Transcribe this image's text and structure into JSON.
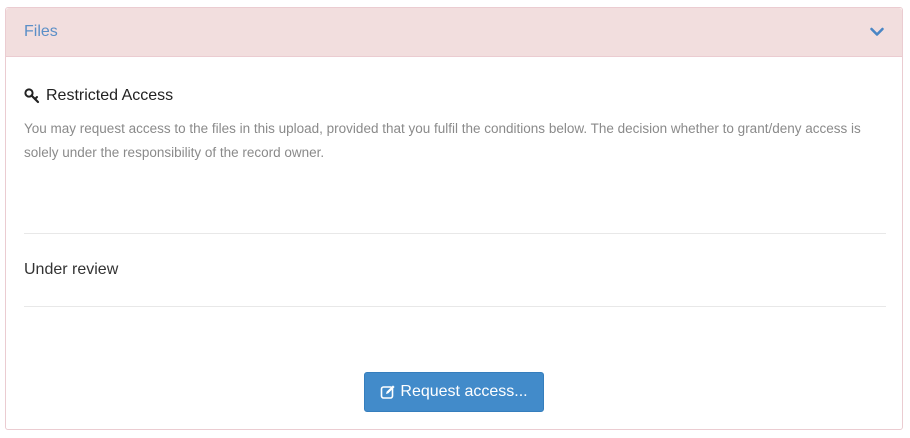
{
  "panel": {
    "title": "Files",
    "toggle_icon": "chevron-down-icon"
  },
  "access": {
    "icon": "key-icon",
    "heading": "Restricted Access",
    "description": "You may request access to the files in this upload, provided that you fulfil the conditions below. The decision whether to grant/deny access is solely under the responsibility of the record owner."
  },
  "status": {
    "text": "Under review"
  },
  "request_button": {
    "icon": "edit-icon",
    "label": "Request access..."
  },
  "colors": {
    "heading_bg": "#f2dede",
    "heading_border": "#ebccd1",
    "title_text": "#5b8fc7",
    "button_bg": "#428bca"
  }
}
